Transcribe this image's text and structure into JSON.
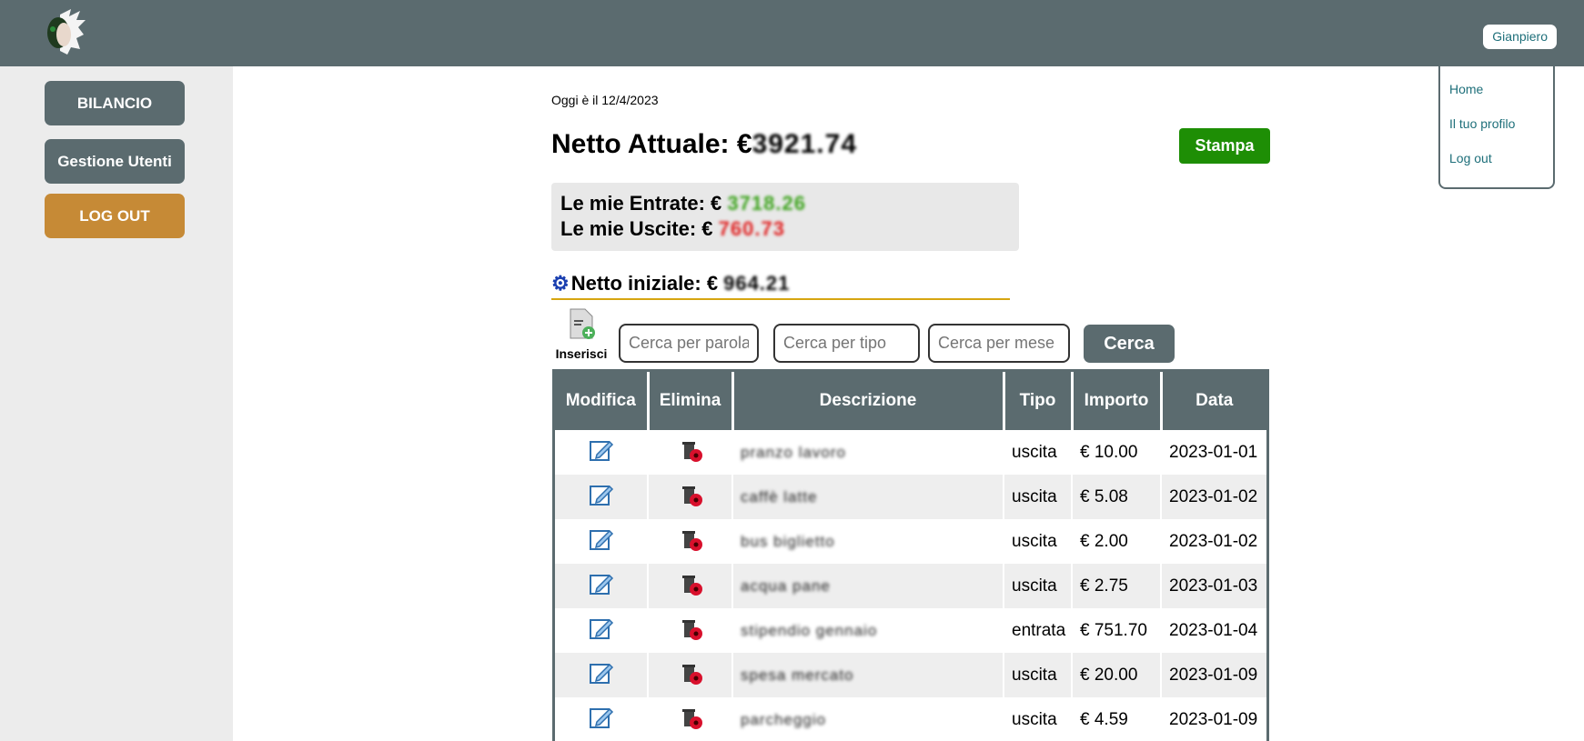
{
  "header": {
    "user_button": "Gianpiero"
  },
  "user_menu": {
    "items": [
      "Home",
      "Il tuo profilo",
      "Log out"
    ]
  },
  "sidebar": {
    "items": [
      {
        "label": "BILANCIO"
      },
      {
        "label": "Gestione Utenti"
      },
      {
        "label": "LOG OUT"
      }
    ]
  },
  "main": {
    "date_text": "Oggi è il 12/4/2023",
    "netto_label": "Netto Attuale: €",
    "netto_value": "3921.74",
    "print_button": "Stampa",
    "entrate_label": "Le mie Entrate: €",
    "entrate_value": "3718.26",
    "uscite_label": "Le mie Uscite: €",
    "uscite_value": "760.73",
    "iniziale_label": "Netto iniziale: €",
    "iniziale_value": "964.21",
    "insert_label": "Inserisci",
    "search_word_placeholder": "Cerca per parola",
    "search_type_placeholder": "Cerca per tipo",
    "search_month_placeholder": "Cerca per mese",
    "search_button": "Cerca"
  },
  "table": {
    "headers": [
      "Modifica",
      "Elimina",
      "Descrizione",
      "Tipo",
      "Importo",
      "Data"
    ],
    "rows": [
      {
        "description": "pranzo lavoro",
        "type": "uscita",
        "amount": "€ 10.00",
        "date": "2023-01-01"
      },
      {
        "description": "caffè latte",
        "type": "uscita",
        "amount": "€ 5.08",
        "date": "2023-01-02"
      },
      {
        "description": "bus biglietto",
        "type": "uscita",
        "amount": "€ 2.00",
        "date": "2023-01-02"
      },
      {
        "description": "acqua pane",
        "type": "uscita",
        "amount": "€ 2.75",
        "date": "2023-01-03"
      },
      {
        "description": "stipendio gennaio",
        "type": "entrata",
        "amount": "€ 751.70",
        "date": "2023-01-04"
      },
      {
        "description": "spesa mercato",
        "type": "uscita",
        "amount": "€ 20.00",
        "date": "2023-01-09"
      },
      {
        "description": "parcheggio",
        "type": "uscita",
        "amount": "€ 4.59",
        "date": "2023-01-09"
      }
    ]
  }
}
